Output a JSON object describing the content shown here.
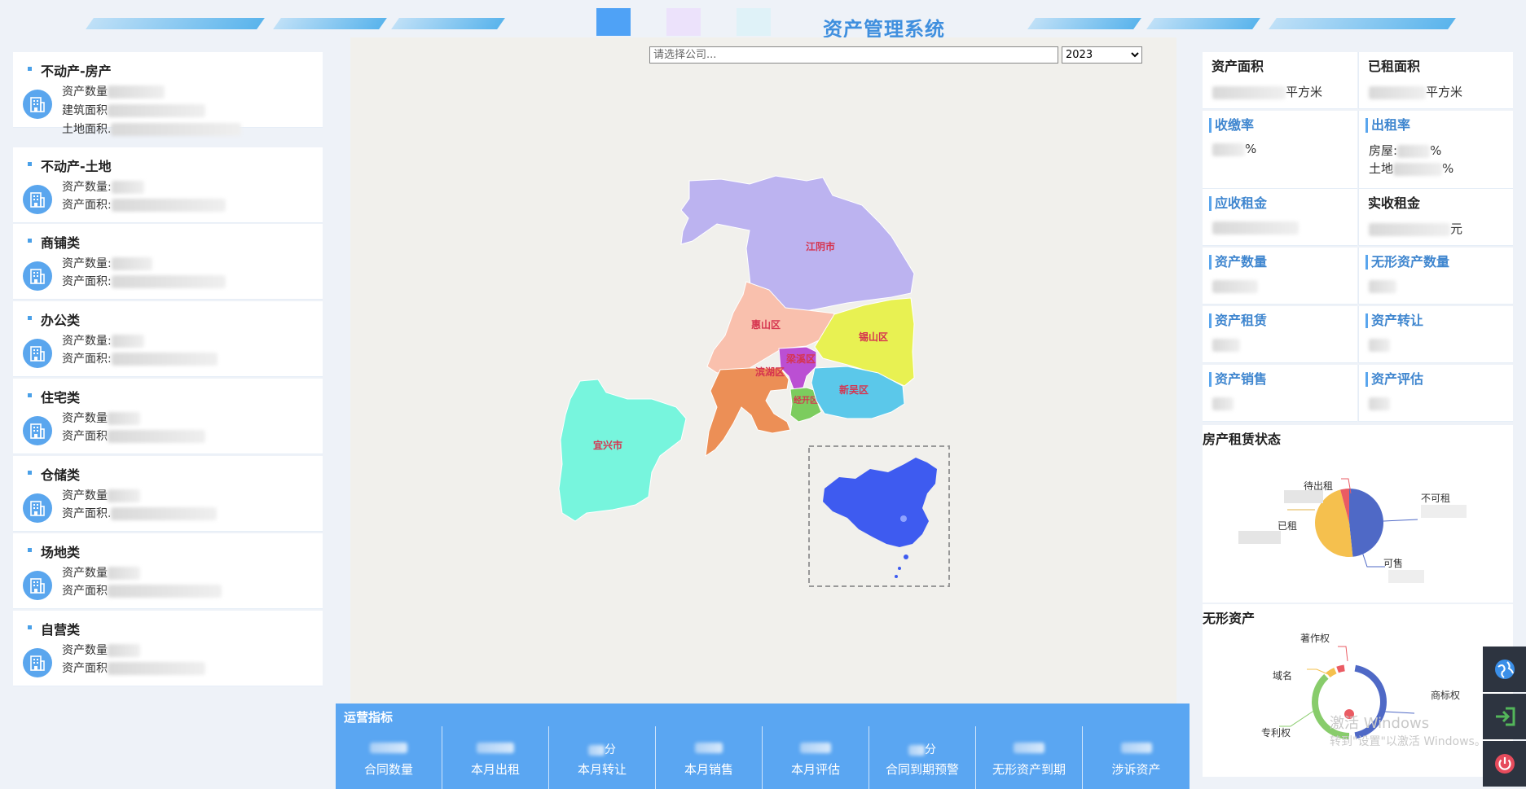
{
  "header": {
    "title": "资产管理系统"
  },
  "filters": {
    "company_placeholder": "请选择公司...",
    "year": "2023",
    "year_options": [
      "2023"
    ]
  },
  "categories": [
    {
      "title": "不动产-房产",
      "lines": [
        "资产数量",
        "建筑面积",
        "土地面积."
      ]
    },
    {
      "title": "不动产-土地",
      "lines": [
        "资产数量:",
        "资产面积:"
      ]
    },
    {
      "title": "商铺类",
      "lines": [
        "资产数量:",
        "资产面积:"
      ]
    },
    {
      "title": "办公类",
      "lines": [
        "资产数量:",
        "资产面积:"
      ]
    },
    {
      "title": "住宅类",
      "lines": [
        "资产数量",
        "资产面积"
      ]
    },
    {
      "title": "仓储类",
      "lines": [
        "资产数量",
        "资产面积."
      ]
    },
    {
      "title": "场地类",
      "lines": [
        "资产数量",
        "资产面积"
      ]
    },
    {
      "title": "自营类",
      "lines": [
        "资产数量",
        "资产面积"
      ]
    }
  ],
  "map": {
    "regions": [
      {
        "name": "江阴市",
        "color": "#bcb3f0"
      },
      {
        "name": "惠山区",
        "color": "#f9c0ad"
      },
      {
        "name": "锡山区",
        "color": "#e8f152"
      },
      {
        "name": "梁溪区",
        "color": "#bb4fd3"
      },
      {
        "name": "滨湖区",
        "color": "#ec8f56"
      },
      {
        "name": "经开区",
        "color": "#7ccc5e"
      },
      {
        "name": "新吴区",
        "color": "#5bc8ea"
      },
      {
        "name": "宜兴市",
        "color": "#77f5dd"
      }
    ],
    "inset_color": "#3e5bf0"
  },
  "ops": {
    "title": "运营指标",
    "items": [
      {
        "label": "合同数量",
        "suffix": ""
      },
      {
        "label": "本月出租",
        "suffix": ""
      },
      {
        "label": "本月转让",
        "suffix": "分"
      },
      {
        "label": "本月销售",
        "suffix": ""
      },
      {
        "label": "本月评估",
        "suffix": ""
      },
      {
        "label": "合同到期预警",
        "suffix": "分"
      },
      {
        "label": "无形资产到期",
        "suffix": ""
      },
      {
        "label": "涉诉资产",
        "suffix": ""
      }
    ]
  },
  "stats": {
    "asset_area": {
      "label": "资产面积",
      "unit": "平方米"
    },
    "rented_area": {
      "label": "已租面积",
      "unit": "平方米"
    },
    "collection_rate": {
      "label": "收缴率",
      "unit": "%"
    },
    "rental_rate": {
      "label": "出租率",
      "house": "房屋:",
      "land": "土地",
      "unit": "%"
    },
    "receivable_rent": {
      "label": "应收租金"
    },
    "received_rent": {
      "label": "实收租金",
      "unit": "元"
    },
    "asset_count": {
      "label": "资产数量"
    },
    "intangible_count": {
      "label": "无形资产数量"
    },
    "asset_lease": {
      "label": "资产租赁"
    },
    "asset_transfer": {
      "label": "资产转让"
    },
    "asset_sale": {
      "label": "资产销售"
    },
    "asset_valuation": {
      "label": "资产评估"
    }
  },
  "rent_status": {
    "title": "房产租赁状态",
    "slices": [
      {
        "name": "不可租",
        "color": "#4f69c6"
      },
      {
        "name": "可售",
        "color": "#4f69c6"
      },
      {
        "name": "已租",
        "color": "#f5c04e"
      },
      {
        "name": "待出租",
        "color": "#ea5b63"
      }
    ]
  },
  "intangible": {
    "title": "无形资产",
    "slices": [
      {
        "name": "商标权",
        "color": "#4f69c6"
      },
      {
        "name": "专利权",
        "color": "#88cc6b"
      },
      {
        "name": "域名",
        "color": "#f5c04e"
      },
      {
        "name": "著作权",
        "color": "#ea5b63"
      }
    ]
  },
  "watermark": {
    "line1": "激活 Windows",
    "line2": "转到\"设置\"以激活 Windows。"
  }
}
